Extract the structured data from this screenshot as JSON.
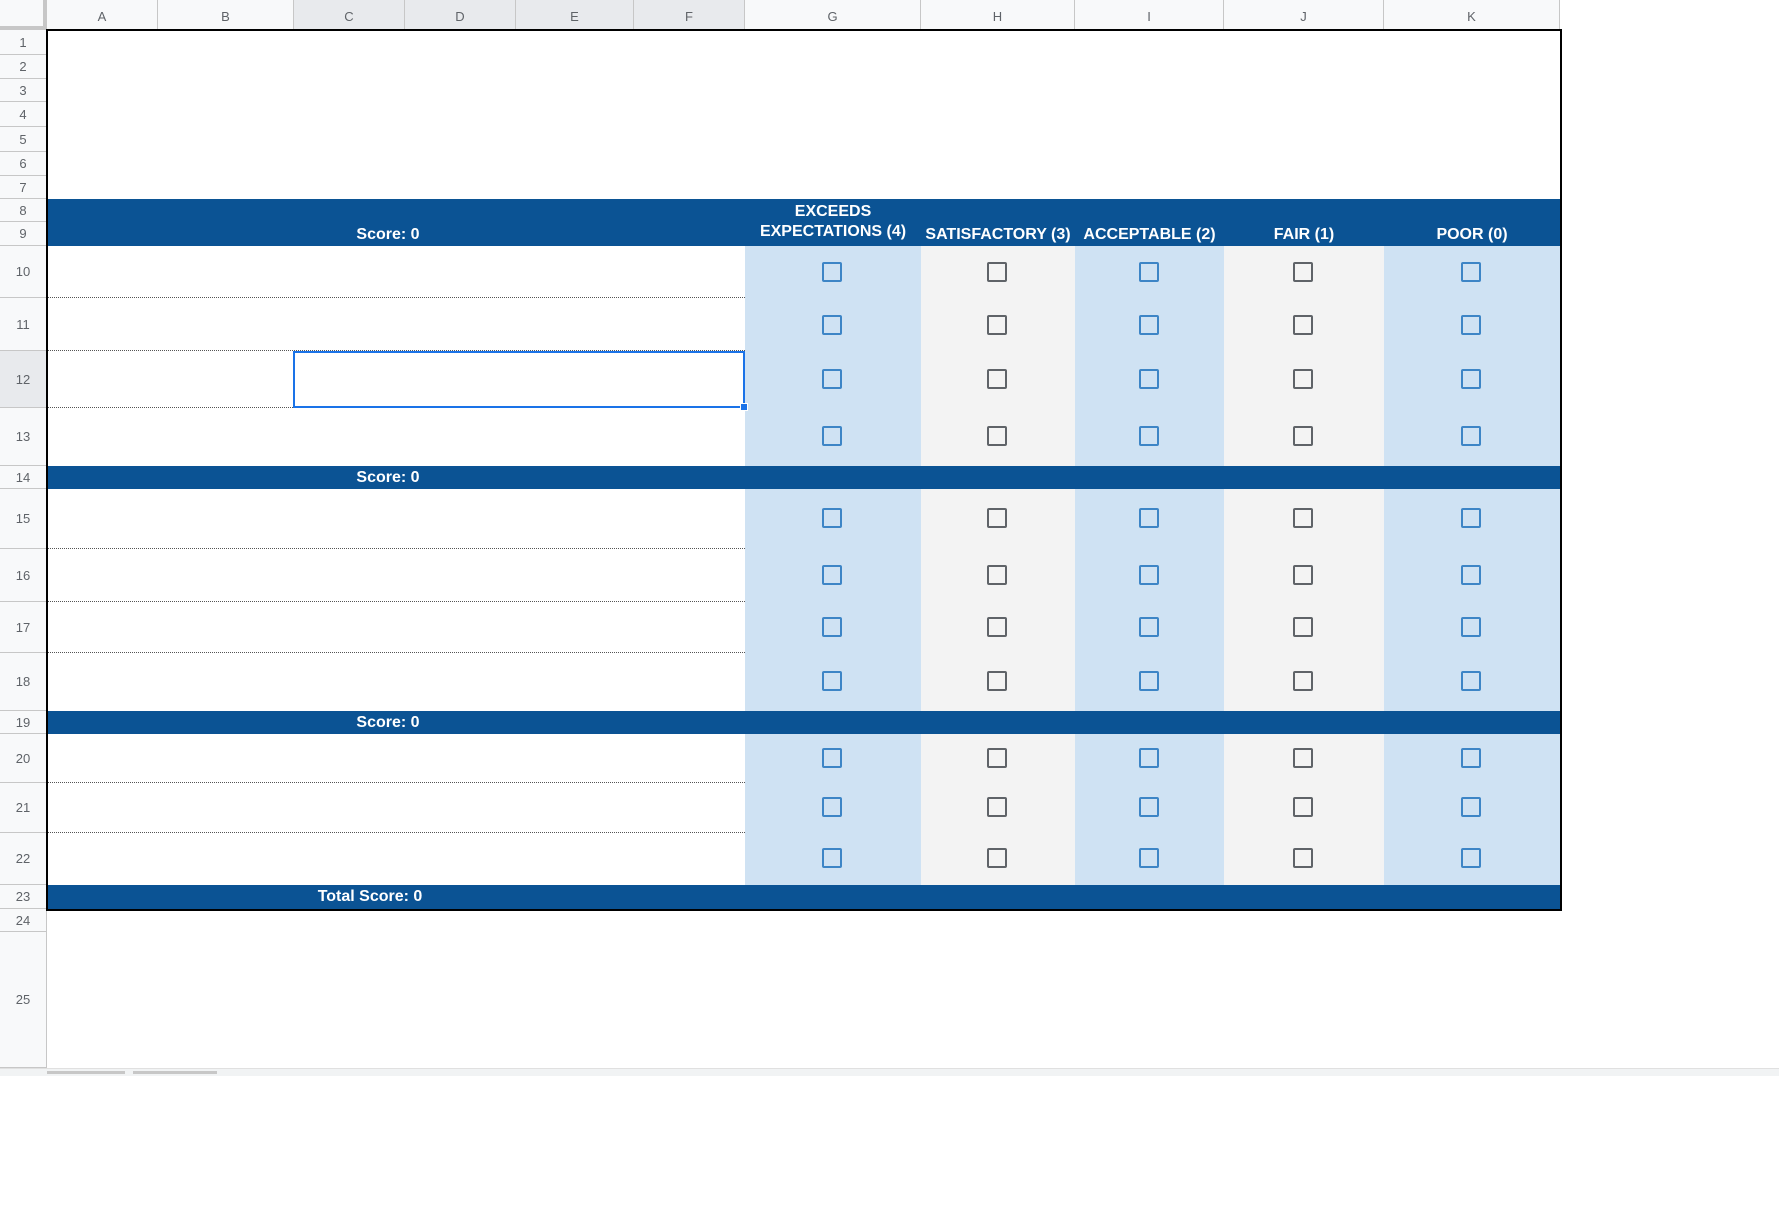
{
  "sheet": {
    "columns": [
      "A",
      "B",
      "C",
      "D",
      "E",
      "F",
      "G",
      "H",
      "I",
      "J",
      "K"
    ],
    "rows": [
      "1",
      "2",
      "3",
      "4",
      "5",
      "6",
      "7",
      "8",
      "9",
      "10",
      "11",
      "12",
      "13",
      "14",
      "15",
      "16",
      "17",
      "18",
      "19",
      "20",
      "21",
      "22",
      "23",
      "24",
      "25"
    ],
    "selected_cell": "C12"
  },
  "rubric": {
    "header_score_label": "Score:  0",
    "ratings": [
      {
        "label": "EXCEEDS EXPECTATIONS (4)",
        "line1": "EXCEEDS",
        "line2": "EXPECTATIONS (4)"
      },
      {
        "label": "SATISFACTORY (3)",
        "line1": "",
        "line2": "SATISFACTORY (3)"
      },
      {
        "label": "ACCEPTABLE (2)",
        "line1": "",
        "line2": "ACCEPTABLE (2)"
      },
      {
        "label": "FAIR (1)",
        "line1": "",
        "line2": "FAIR (1)"
      },
      {
        "label": "POOR (0)",
        "line1": "",
        "line2": "POOR (0)"
      }
    ],
    "section_scores": [
      "Score:  0",
      "Score:  0"
    ],
    "total_score_label": "Total Score:  0",
    "checkbox_state": "unchecked"
  },
  "colors": {
    "header_band": "#0b5394",
    "column_blue": "#cfe2f3",
    "column_gray": "#f3f3f3",
    "selection": "#1a73e8"
  }
}
